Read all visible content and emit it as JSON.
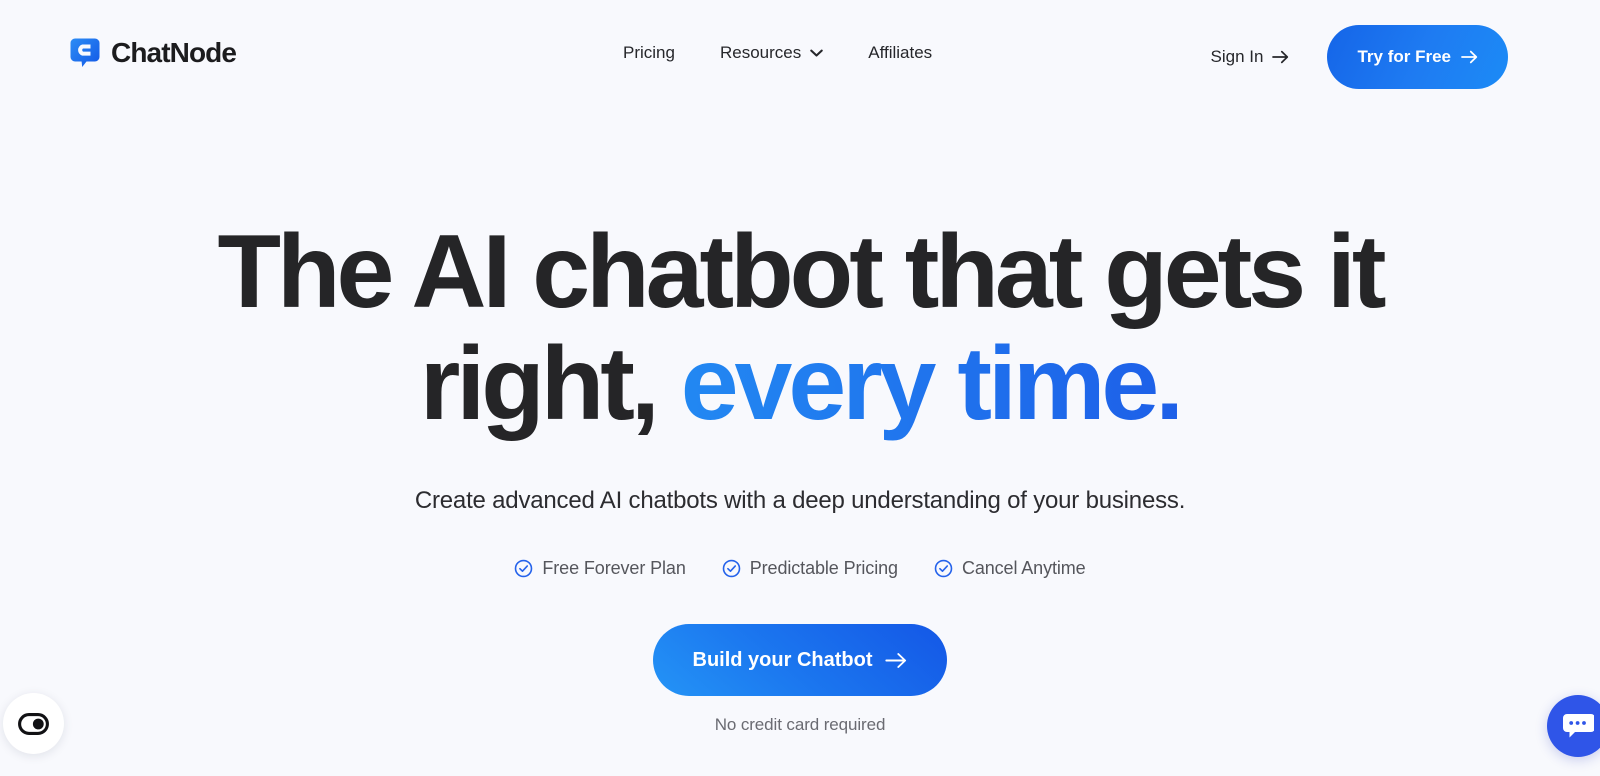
{
  "theme": {
    "page_background": "#F8F9FD",
    "headline_color": "#252527",
    "accent_blue": "#1F6FEC",
    "accent_blue_light": "#2288F2",
    "accent_blue_deep": "#1D5FE8",
    "check_icon_color": "#2563EB",
    "chat_bubble_color": "#2F55E8",
    "muted_text": "#6A6B72"
  },
  "header": {
    "brand": {
      "name": "ChatNode",
      "logo_icon": "chatnode-speech-bubble-logo"
    },
    "nav_items": [
      {
        "label": "Pricing",
        "has_dropdown": false
      },
      {
        "label": "Resources",
        "has_dropdown": true,
        "dropdown_icon": "chevron-down-icon"
      },
      {
        "label": "Affiliates",
        "has_dropdown": false
      }
    ],
    "sign_in": {
      "label": "Sign In",
      "icon": "arrow-right-icon"
    },
    "try_free": {
      "label": "Try for Free",
      "icon": "arrow-right-icon"
    }
  },
  "hero": {
    "headline_line1": "The AI chatbot that gets it",
    "headline_line2_dark": "right, ",
    "headline_line2_blue": "every time.",
    "subheadline": "Create advanced AI chatbots with a deep understanding of your business.",
    "features": [
      {
        "label": "Free Forever Plan",
        "icon": "circle-check-icon"
      },
      {
        "label": "Predictable Pricing",
        "icon": "circle-check-icon"
      },
      {
        "label": "Cancel Anytime",
        "icon": "circle-check-icon"
      }
    ],
    "cta": {
      "label": "Build your Chatbot",
      "icon": "arrow-right-icon"
    },
    "cta_note": "No credit card required"
  },
  "widgets": {
    "cookie_consent": {
      "icon": "cookie-consent-toggle-icon"
    },
    "chat_launcher": {
      "icon": "chat-bubble-dots-icon"
    }
  }
}
